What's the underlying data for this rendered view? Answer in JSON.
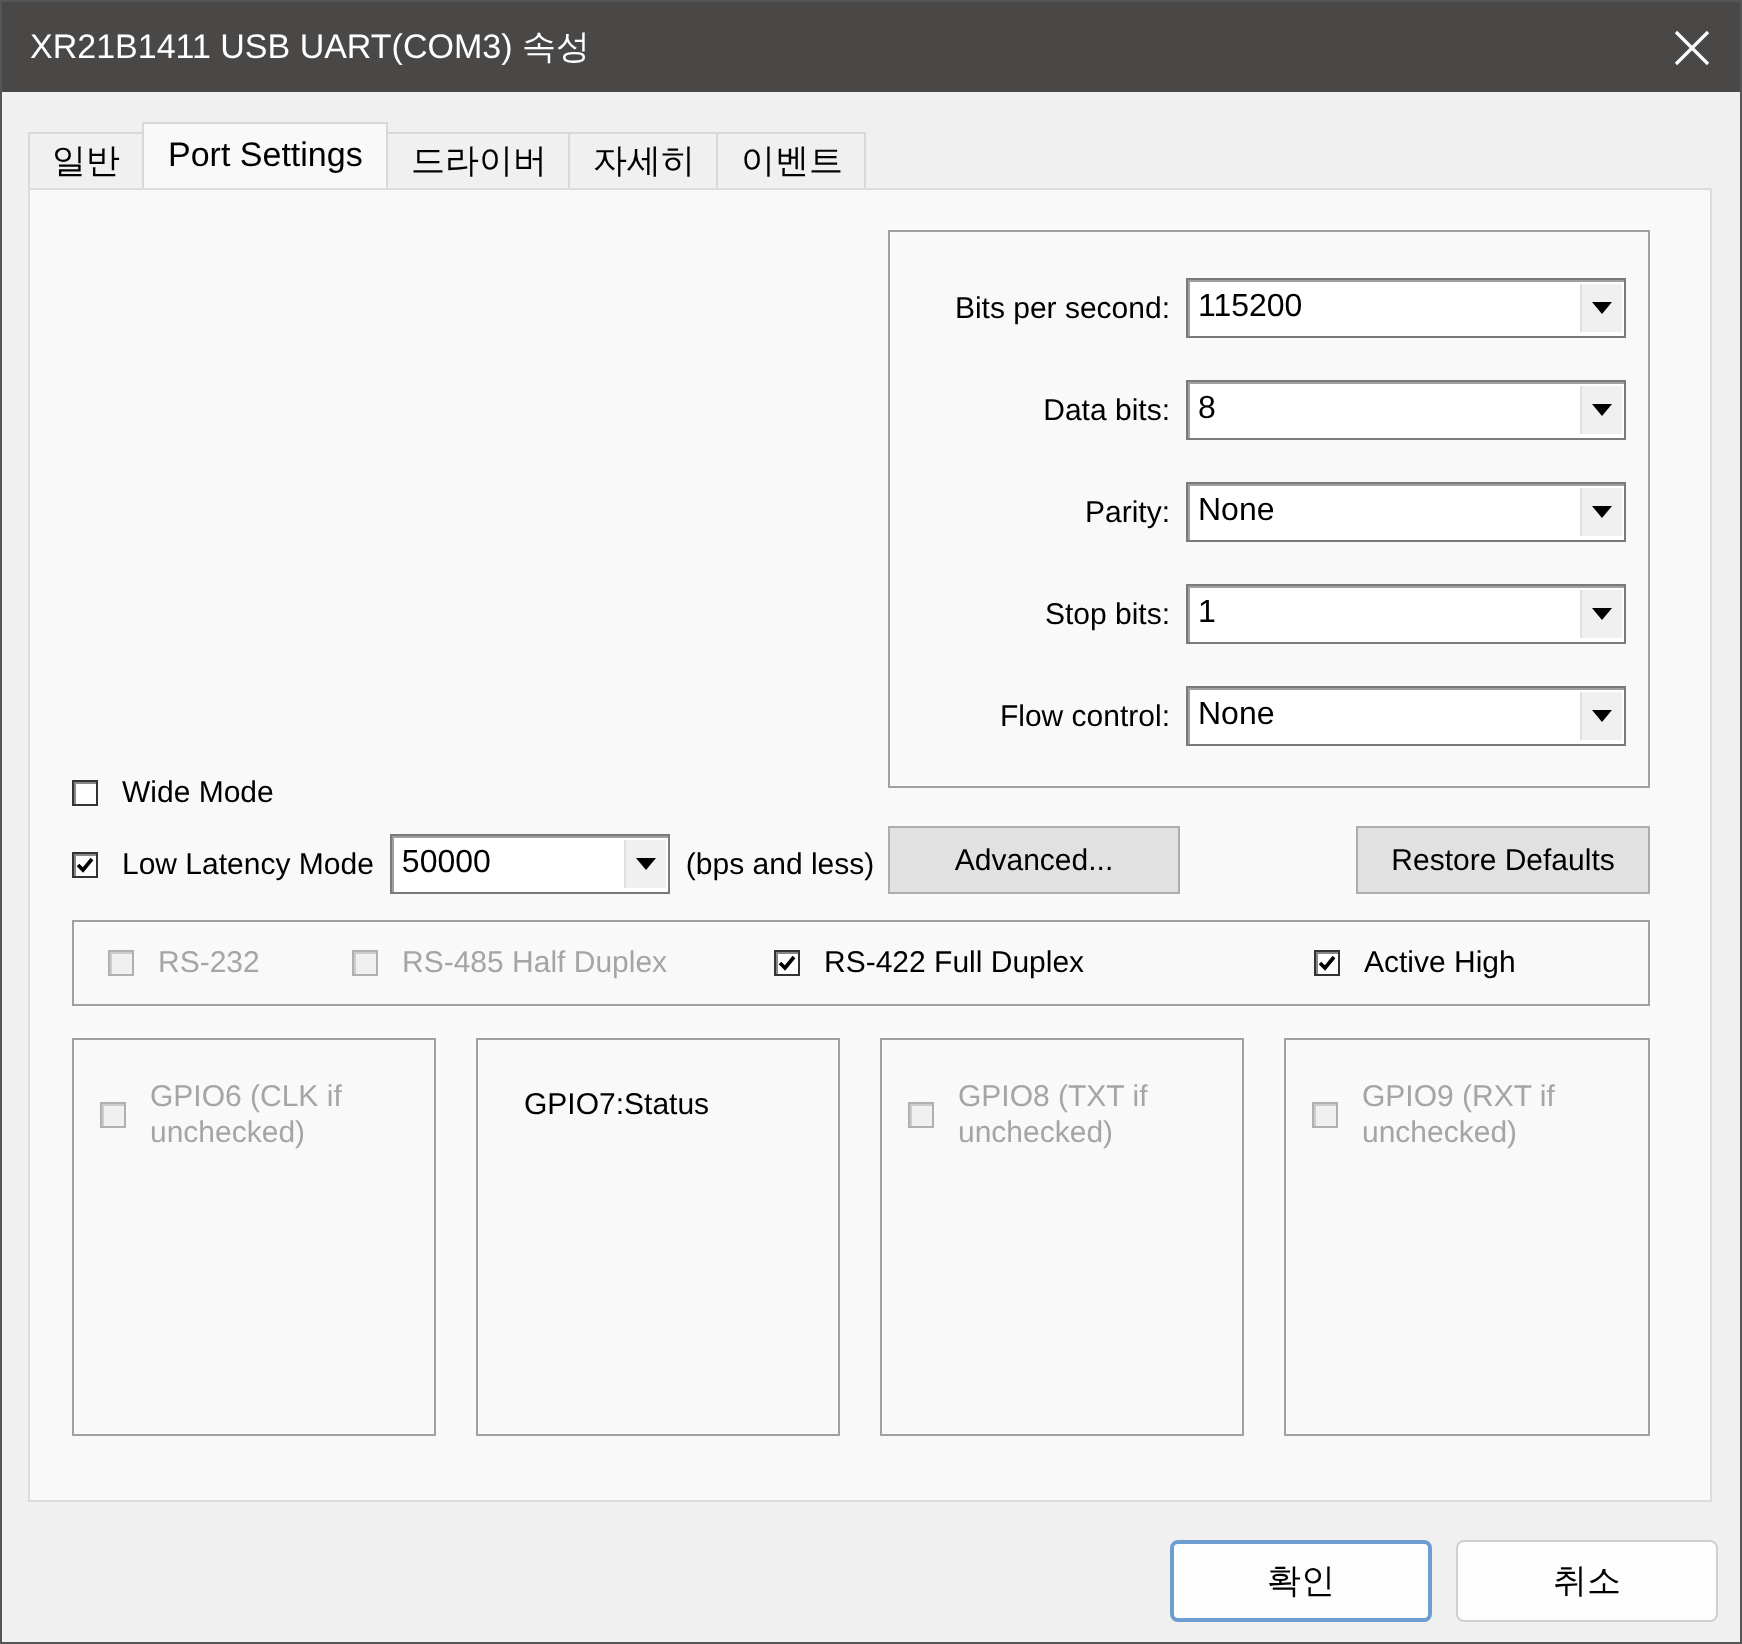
{
  "window": {
    "title": "XR21B1411 USB UART(COM3) 속성"
  },
  "tabs": [
    {
      "label": "일반",
      "selected": false
    },
    {
      "label": "Port Settings",
      "selected": true
    },
    {
      "label": "드라이버",
      "selected": false
    },
    {
      "label": "자세히",
      "selected": false
    },
    {
      "label": "이벤트",
      "selected": false
    }
  ],
  "settings": [
    {
      "label": "Bits per second:",
      "value": "115200"
    },
    {
      "label": "Data bits:",
      "value": "8"
    },
    {
      "label": "Parity:",
      "value": "None"
    },
    {
      "label": "Stop bits:",
      "value": "1"
    },
    {
      "label": "Flow control:",
      "value": "None"
    }
  ],
  "wide_mode": {
    "label": "Wide Mode",
    "checked": false
  },
  "low_latency": {
    "label": "Low Latency Mode",
    "checked": true,
    "value": "50000",
    "suffix": "(bps and less)"
  },
  "actions": [
    "Advanced...",
    "Restore Defaults"
  ],
  "modes": [
    {
      "label": "RS-232",
      "checked": false,
      "disabled": true
    },
    {
      "label": "RS-485 Half Duplex",
      "checked": false,
      "disabled": true
    },
    {
      "label": "RS-422 Full Duplex",
      "checked": true,
      "disabled": false
    },
    {
      "label": "Active High",
      "checked": true,
      "disabled": false
    }
  ],
  "gpio": [
    {
      "kind": "checkbox",
      "label": "GPIO6 (CLK if unchecked)",
      "checked": false,
      "disabled": true
    },
    {
      "kind": "label",
      "label": "GPIO7:Status"
    },
    {
      "kind": "checkbox",
      "label": "GPIO8 (TXT if unchecked)",
      "checked": false,
      "disabled": true
    },
    {
      "kind": "checkbox",
      "label": "GPIO9 (RXT if unchecked)",
      "checked": false,
      "disabled": true
    }
  ],
  "footer_buttons": [
    {
      "label": "확인",
      "default": true
    },
    {
      "label": "취소",
      "default": false
    }
  ]
}
